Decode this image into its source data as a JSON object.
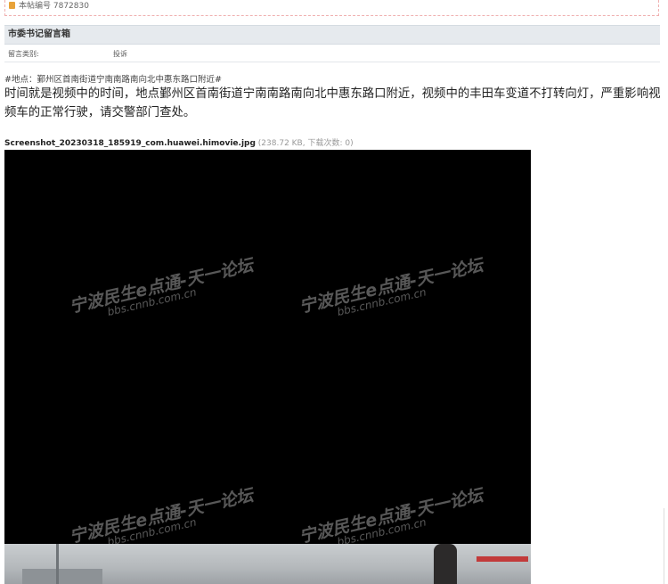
{
  "post": {
    "id_label": "本帖编号 7872830",
    "category_title": "市委书记留言箱",
    "type_label": "留言类别:",
    "type_value": "投诉",
    "location": "#地点：鄞州区首南街道宁南南路南向北中惠东路口附近#",
    "body": "时间就是视频中的时间，地点鄞州区首南街道宁南南路南向北中惠东路口附近，视频中的丰田车变道不打转向灯，严重影响视频车的正常行驶，请交警部门查处。"
  },
  "attachment": {
    "filename": "Screenshot_20230318_185919_com.huawei.himovie.jpg",
    "meta": "(238.72 KB, 下载次数: 0)"
  },
  "watermark": {
    "main": "宁波民生e点通-天一论坛",
    "sub": "bbs.cnnb.com.cn"
  },
  "icons": {
    "post_id": "document-icon"
  }
}
